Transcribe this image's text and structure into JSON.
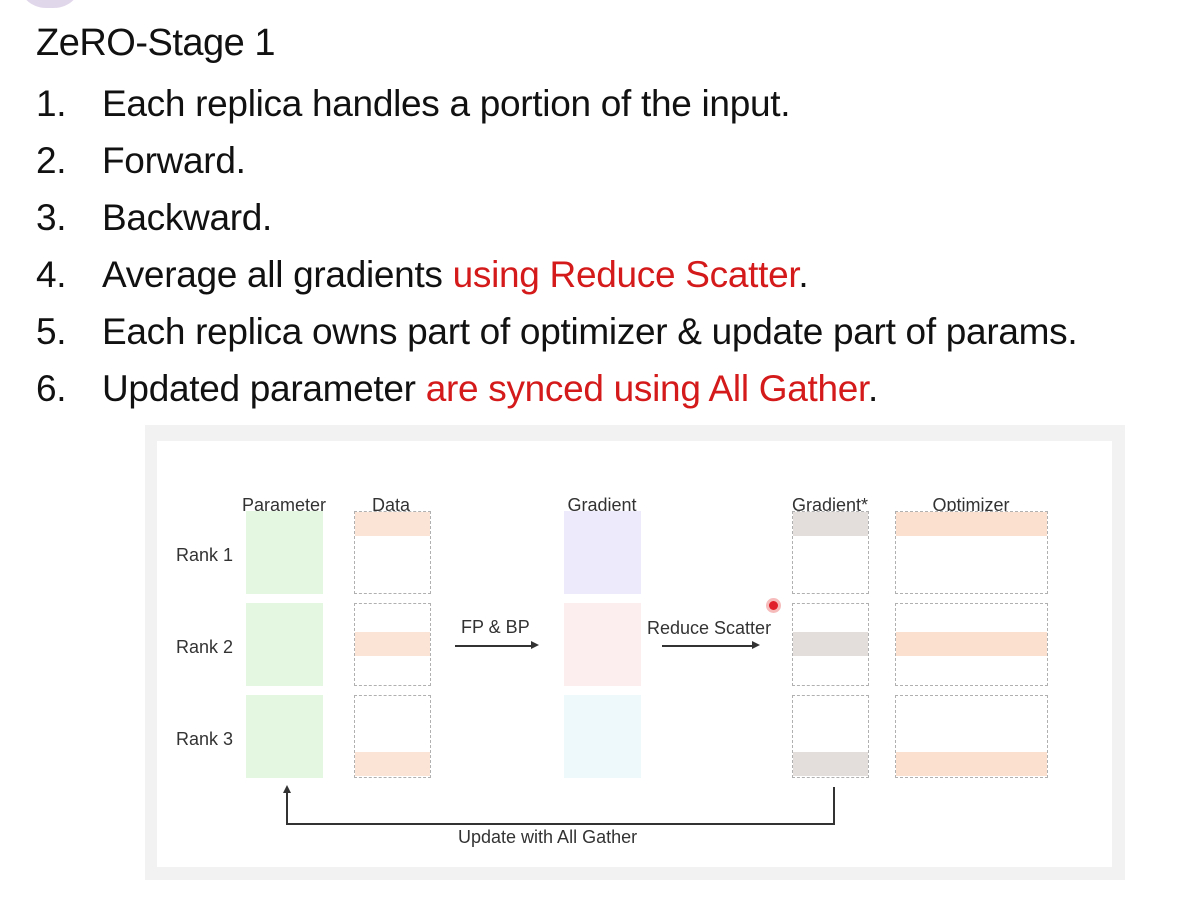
{
  "title": "ZeRO-Stage 1",
  "steps": [
    {
      "num": "1.",
      "text": "Each replica handles a portion of the input.",
      "red": "",
      "tail": ""
    },
    {
      "num": "2.",
      "text": "Forward.",
      "red": "",
      "tail": ""
    },
    {
      "num": "3.",
      "text": "Backward.",
      "red": "",
      "tail": ""
    },
    {
      "num": "4.",
      "text": "Average all gradients ",
      "red": "using Reduce Scatter",
      "tail": "."
    },
    {
      "num": "5.",
      "text": "Each replica owns part of optimizer & update part of params.",
      "red": "",
      "tail": ""
    },
    {
      "num": "6.",
      "text": "Updated parameter ",
      "red": "are synced using All Gather",
      "tail": "."
    }
  ],
  "diagram": {
    "columns": {
      "parameter": "Parameter",
      "data": "Data",
      "gradient": "Gradient",
      "gradient_star": "Gradient*",
      "optimizer": "Optimizer"
    },
    "rows": [
      "Rank 1",
      "Rank 2",
      "Rank 3"
    ],
    "fp_bp": "FP & BP",
    "reduce_scatter": "Reduce Scatter",
    "all_gather": "Update with All Gather",
    "colors": {
      "parameter": "#e3f7e1",
      "data_stripe": "#fbe4d6",
      "gradient_rank1": "#eceafb",
      "gradient_rank2": "#fceeee",
      "gradient_rank3": "#eef9fc",
      "gradient_star_stripe": "#e3dedb",
      "optimizer_stripe": "#fbe0cf",
      "highlight": "#d41a1a"
    }
  }
}
